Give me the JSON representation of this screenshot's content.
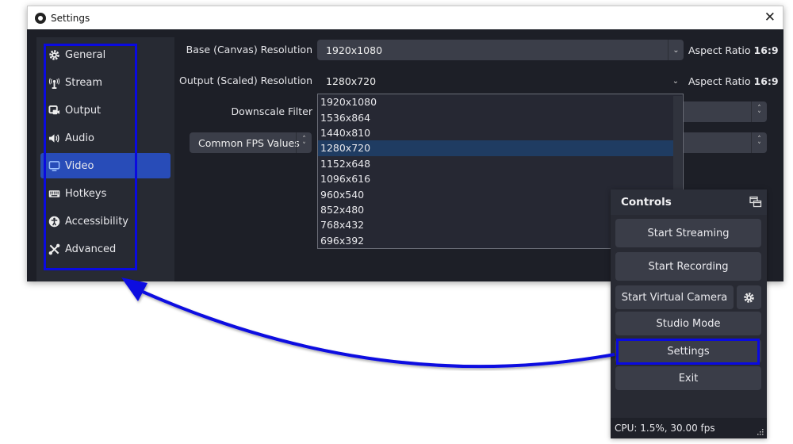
{
  "window": {
    "title": "Settings",
    "close_label": "✕"
  },
  "sidebar": {
    "items": [
      {
        "label": "General",
        "icon": "gear-icon"
      },
      {
        "label": "Stream",
        "icon": "antenna-icon"
      },
      {
        "label": "Output",
        "icon": "output-icon"
      },
      {
        "label": "Audio",
        "icon": "speaker-icon"
      },
      {
        "label": "Video",
        "icon": "monitor-icon",
        "active": true
      },
      {
        "label": "Hotkeys",
        "icon": "keyboard-icon"
      },
      {
        "label": "Accessibility",
        "icon": "accessibility-icon"
      },
      {
        "label": "Advanced",
        "icon": "tools-icon"
      }
    ]
  },
  "video": {
    "base_label": "Base (Canvas) Resolution",
    "base_value": "1920x1080",
    "base_aspect_prefix": "Aspect Ratio",
    "base_aspect_value": "16:9",
    "output_label": "Output (Scaled) Resolution",
    "output_value": "1280x720",
    "output_aspect_prefix": "Aspect Ratio",
    "output_aspect_value": "16:9",
    "downscale_label": "Downscale Filter",
    "fps_label": "Common FPS Values",
    "resolution_options": [
      "1920x1080",
      "1536x864",
      "1440x810",
      "1280x720",
      "1152x648",
      "1096x616",
      "960x540",
      "852x480",
      "768x432",
      "696x392"
    ],
    "selected_option": "1280x720"
  },
  "controls": {
    "title": "Controls",
    "start_streaming": "Start Streaming",
    "start_recording": "Start Recording",
    "start_virtual_camera": "Start Virtual Camera",
    "studio_mode": "Studio Mode",
    "settings": "Settings",
    "exit": "Exit",
    "status": "CPU: 1.5%, 30.00 fps"
  },
  "annotation": {
    "color": "#0a0ae0"
  },
  "colors": {
    "accent": "#284cb8",
    "selected_row": "#1f3c62",
    "panel_bg": "#1d1f27"
  }
}
